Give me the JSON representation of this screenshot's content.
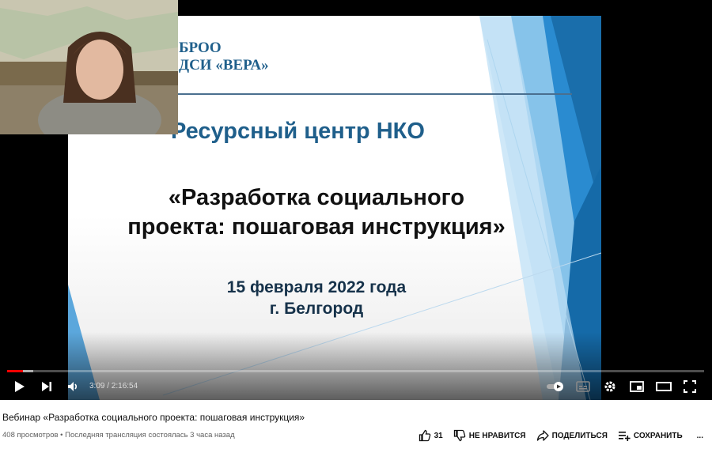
{
  "slide": {
    "org_line1": "БРОО",
    "org_line2": "ДСИ «ВЕРА»",
    "heading": "Ресурсный центр НКО",
    "title_line1": "«Разработка социального",
    "title_line2": "проекта: пошаговая инструкция»",
    "date_line1": "15 февраля 2022 года",
    "date_line2": "г. Белгород"
  },
  "player": {
    "time_display": "3:09 / 2:16:54",
    "progress_played_percent": 2.3,
    "progress_loaded_percent": 3.8,
    "icons": [
      "play-icon",
      "next-icon",
      "volume-icon",
      "autoplay-toggle-icon",
      "subtitles-icon",
      "settings-icon",
      "miniplayer-icon",
      "theater-icon",
      "fullscreen-icon"
    ]
  },
  "video": {
    "title": "Вебинар «Разработка социального проекта: пошаговая инструкция»",
    "meta": "408 просмотров • Последняя трансляция состоялась 3 часа назад"
  },
  "actions": {
    "like_count": "31",
    "dislike_label": "НЕ НРАВИТСЯ",
    "share_label": "ПОДЕЛИТЬСЯ",
    "save_label": "СОХРАНИТЬ",
    "more_label": "..."
  },
  "colors": {
    "progress": "#ff0000",
    "slide_blue": "#1f5f8b",
    "deco_blue": "#2a8bd0"
  }
}
